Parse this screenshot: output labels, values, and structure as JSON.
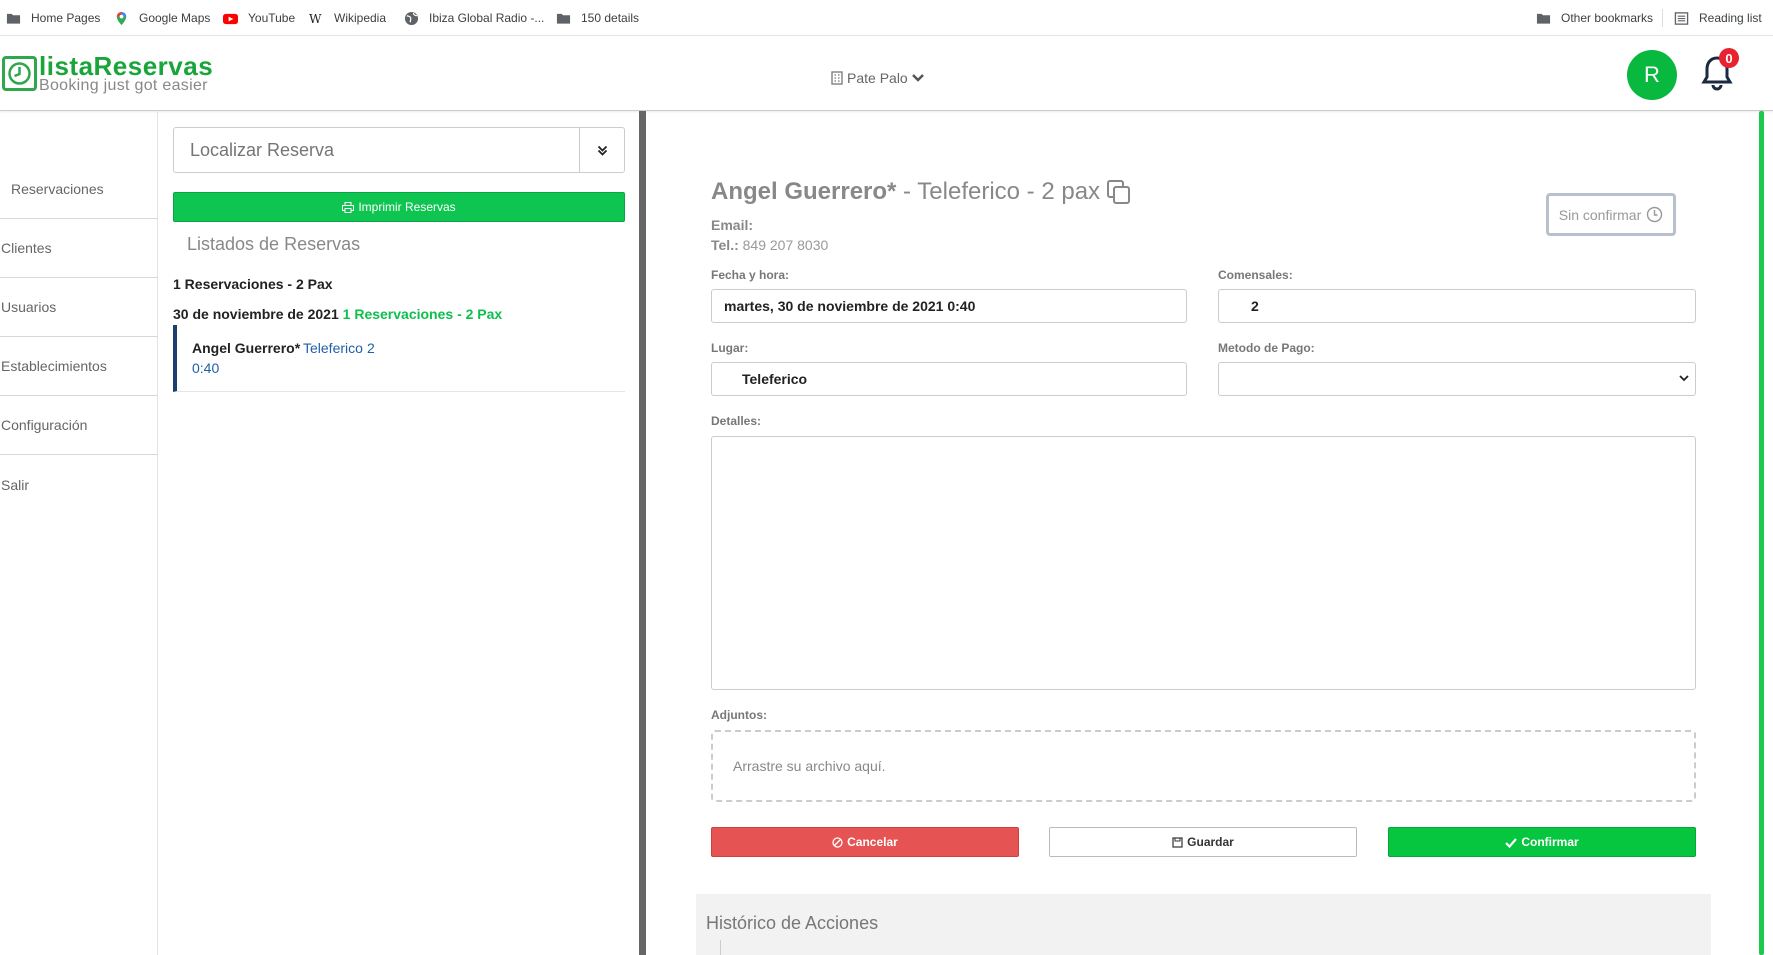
{
  "bookmarks": {
    "items": [
      {
        "label": "Home Pages",
        "icon": "folder-icon"
      },
      {
        "label": "Google Maps",
        "icon": "google-maps-icon"
      },
      {
        "label": "YouTube",
        "icon": "youtube-icon"
      },
      {
        "label": "Wikipedia",
        "icon": "wikipedia-icon"
      },
      {
        "label": "Ibiza Global Radio -...",
        "icon": "globe-icon"
      },
      {
        "label": "150 details",
        "icon": "folder-icon"
      }
    ],
    "other_bookmarks": "Other bookmarks",
    "reading_list": "Reading list"
  },
  "header": {
    "logo_title": "listaReservas",
    "logo_subtitle": "Booking just got easier",
    "venue": "Pate Palo",
    "avatar_letter": "R",
    "notification_count": "0",
    "brand_color": "#1aa53a"
  },
  "nav": {
    "items": [
      {
        "label": "Reservaciones"
      },
      {
        "label": "Clientes"
      },
      {
        "label": "Usuarios"
      },
      {
        "label": "Establecimientos"
      },
      {
        "label": "Configuración"
      },
      {
        "label": "Salir"
      }
    ]
  },
  "list": {
    "search_placeholder": "Localizar Reserva",
    "print_label": "Imprimir Reservas",
    "title": "Listados de Reservas",
    "summary": "1 Reservaciones - 2 Pax",
    "date": "30 de noviembre de 2021",
    "date_summary": "1 Reservaciones - 2 Pax",
    "reservations": [
      {
        "name": "Angel Guerrero*",
        "place": "Teleferico",
        "pax": "2",
        "time": "0:40"
      }
    ]
  },
  "detail": {
    "name": "Angel Guerrero*",
    "subtitle": " - Teleferico - 2 pax",
    "status": "Sin confirmar",
    "email_label": "Email:",
    "email": "",
    "tel_label": "Tel.:",
    "tel": "849 207 8030",
    "fecha_label": "Fecha y hora:",
    "fecha_value": "martes, 30 de noviembre de 2021 0:40",
    "comensales_label": "Comensales:",
    "comensales_value": "2",
    "lugar_label": "Lugar:",
    "lugar_value": "Teleferico",
    "metodo_label": "Metodo de Pago:",
    "metodo_value": "",
    "detalles_label": "Detalles:",
    "adjuntos_label": "Adjuntos:",
    "dropzone_text": "Arrastre su archivo aquí.",
    "cancel_label": "Cancelar",
    "save_label": "Guardar",
    "confirm_label": "Confirmar",
    "history_title": "Histórico de Acciones"
  },
  "colors": {
    "green": "#0fc552",
    "red": "#e55353",
    "navy": "#1c3f6e"
  }
}
